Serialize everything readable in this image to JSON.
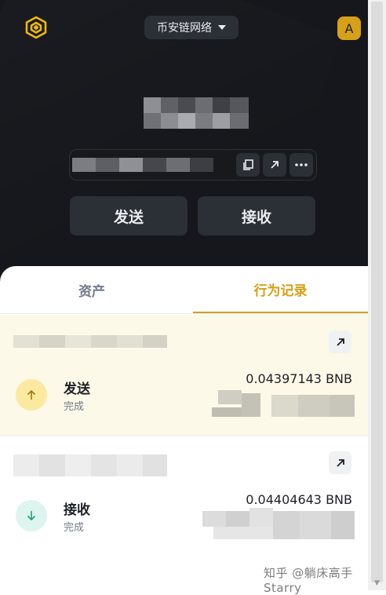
{
  "header": {
    "network_label": "币安链网络",
    "avatar_letter": "A"
  },
  "actions": {
    "send_label": "发送",
    "receive_label": "接收"
  },
  "tabs": [
    {
      "label": "资产",
      "active": false
    },
    {
      "label": "行为记录",
      "active": true
    }
  ],
  "transactions": [
    {
      "type": "发送",
      "status": "完成",
      "amount": "0.04397143 BNB",
      "direction": "send",
      "icon": "arrow-up-icon"
    },
    {
      "type": "接收",
      "status": "完成",
      "amount": "0.04404643 BNB",
      "direction": "receive",
      "icon": "arrow-down-icon"
    }
  ],
  "watermark": "知乎 @躺床高手Starry",
  "colors": {
    "background": "#16171c",
    "button": "#2b2f36",
    "accent": "#d6a017",
    "send_circle": "#fbe9a0",
    "receive_circle": "#ddf5ee",
    "highlight_row": "#fdf9e8"
  }
}
